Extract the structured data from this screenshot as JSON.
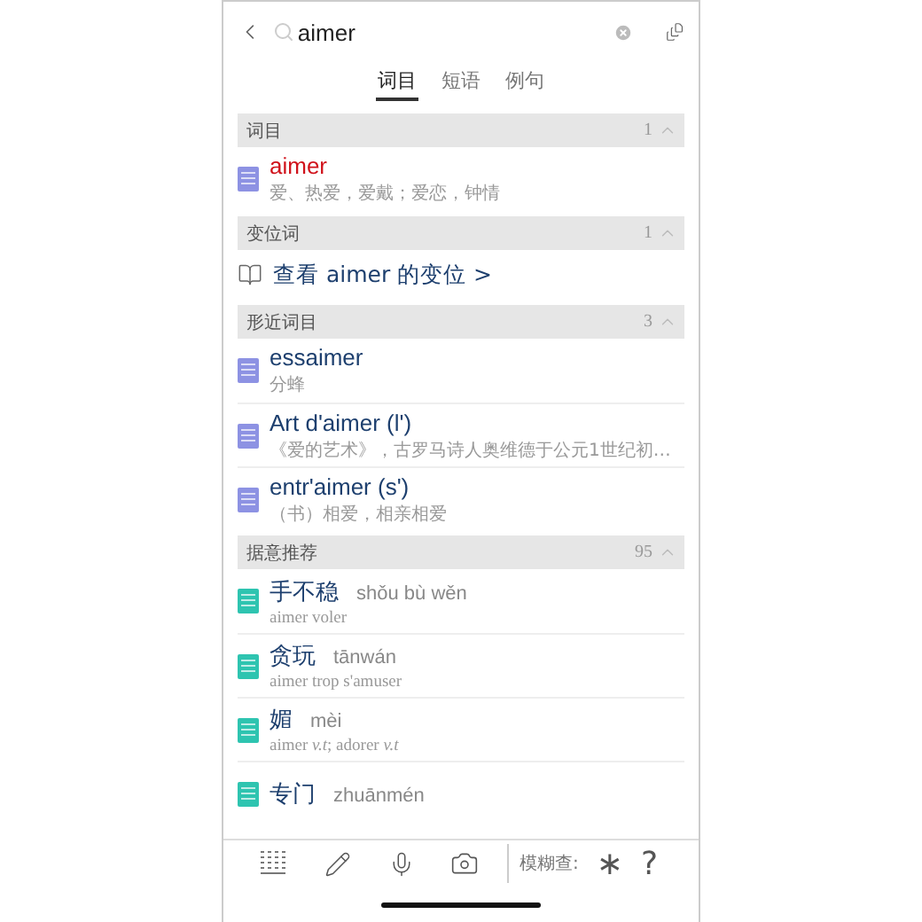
{
  "search": {
    "value": "aimer"
  },
  "tabs": [
    {
      "label": "词目",
      "selected": true
    },
    {
      "label": "短语",
      "selected": false
    },
    {
      "label": "例句",
      "selected": false
    }
  ],
  "sections": [
    {
      "title": "词目",
      "count": "1",
      "expanded": true,
      "items": [
        {
          "kind": "entry",
          "headword": "aimer",
          "highlight": true,
          "gloss": "爱、热爱，爱戴；爱恋，钟情",
          "color": "#8d92e3"
        }
      ]
    },
    {
      "title": "变位词",
      "count": "1",
      "expanded": true,
      "items": [
        {
          "kind": "link",
          "text": "查看 aimer 的变位 >"
        }
      ]
    },
    {
      "title": "形近词目",
      "count": "3",
      "expanded": true,
      "items": [
        {
          "kind": "entry",
          "headword": "essaimer",
          "highlight": false,
          "gloss": "分蜂",
          "color": "#8d92e3"
        },
        {
          "kind": "entry",
          "headword": "Art d'aimer (l')",
          "highlight": false,
          "gloss": "《爱的艺术》，古罗马诗人奥维德于公元1世纪初…",
          "color": "#8d92e3"
        },
        {
          "kind": "entry",
          "headword": "entr'aimer (s')",
          "highlight": false,
          "gloss": "（书）相爱，相亲相爱",
          "color": "#8d92e3"
        }
      ]
    },
    {
      "title": "据意推荐",
      "count": "95",
      "expanded": true,
      "items": [
        {
          "kind": "chinese",
          "headword": "手不稳",
          "pinyin": "shǒu bù wěn",
          "gloss": "aimer voler",
          "color": "#2ec4b0"
        },
        {
          "kind": "chinese",
          "headword": "贪玩",
          "pinyin": "tānwán",
          "gloss": "aimer trop s'amuser",
          "color": "#2ec4b0"
        },
        {
          "kind": "chinese",
          "headword": "媚",
          "pinyin": "mèi",
          "gloss": "aimer *v.t*; adorer *v.t*",
          "color": "#2ec4b0"
        },
        {
          "kind": "chinese",
          "headword": "专门",
          "pinyin": "zhuānmén",
          "color": "#2ec4b0"
        }
      ]
    }
  ],
  "toolbar": {
    "fuzzy_label": "模糊查:",
    "wildcards": [
      "∗",
      "?"
    ]
  }
}
